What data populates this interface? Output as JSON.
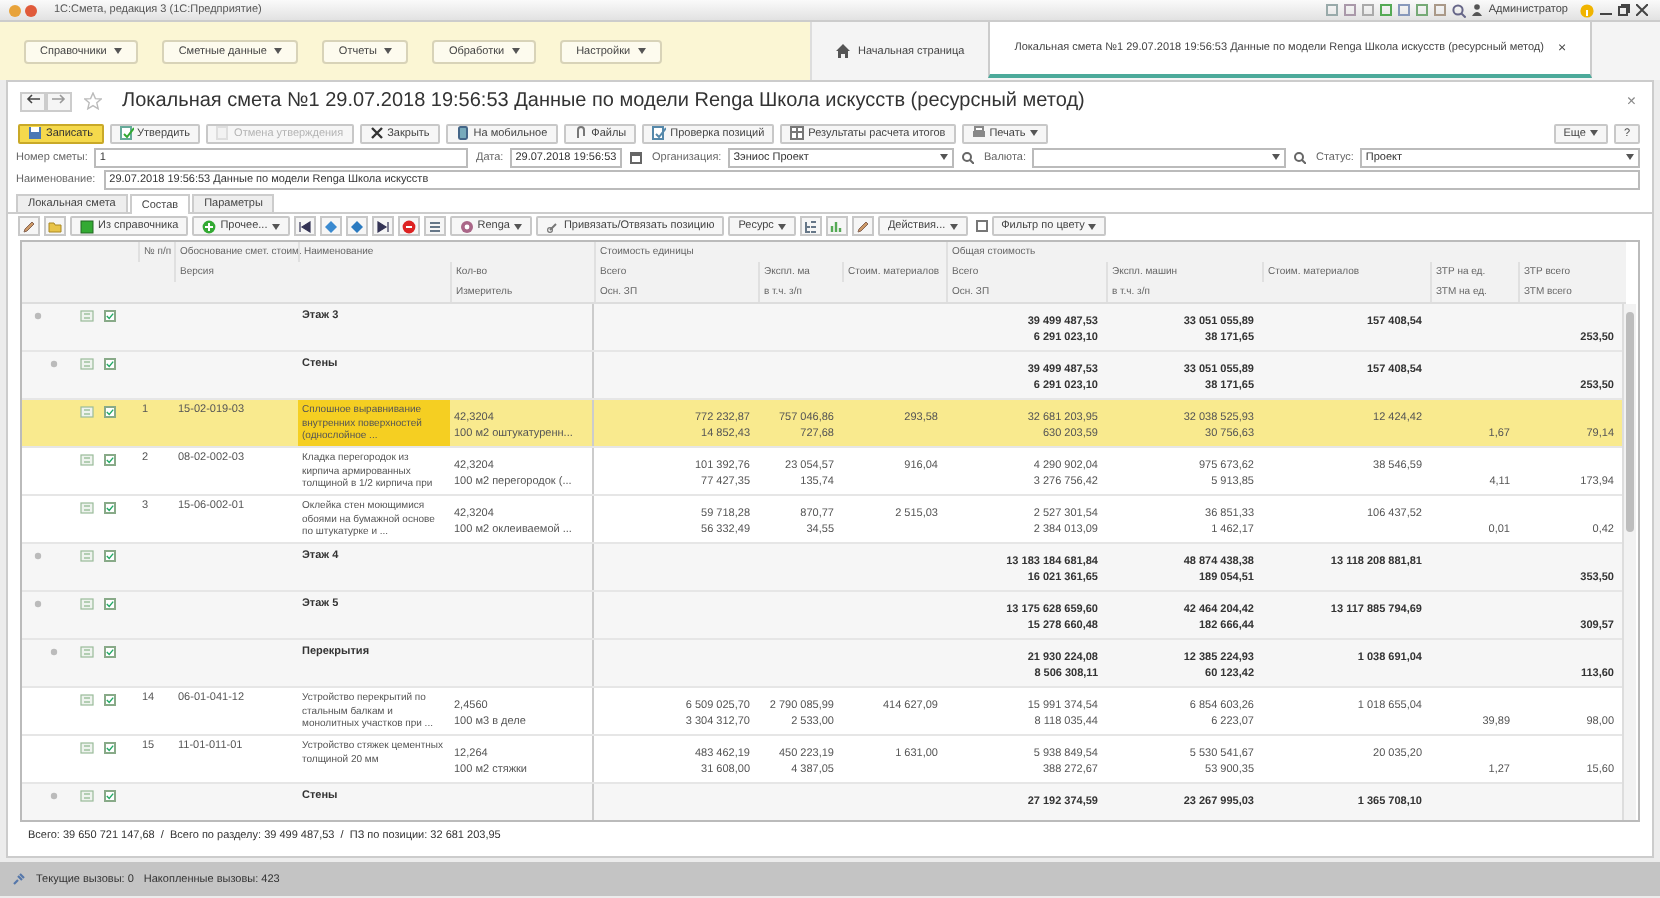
{
  "window": {
    "title": "1С:Смета, редакция 3  (1С:Предприятие)",
    "user": "Администратор"
  },
  "menu": [
    {
      "label": "Справочники"
    },
    {
      "label": "Сметные данные"
    },
    {
      "label": "Отчеты"
    },
    {
      "label": "Обработки"
    },
    {
      "label": "Настройки"
    }
  ],
  "page_tabs": [
    {
      "kind": "home",
      "label": "Начальная страница",
      "selected": false
    },
    {
      "kind": "document",
      "label": "Локальная смета №1 29.07.2018 19:56:53 Данные по модели Renga Школа искусств (ресурсный метод)",
      "selected": true,
      "close": "×"
    }
  ],
  "document": {
    "title": "Локальная смета №1 29.07.2018 19:56:53 Данные по модели Renga Школа искусств (ресурсный метод)",
    "close": "×"
  },
  "toolbar": [
    {
      "label": "Записать",
      "kind": "primary",
      "disabled": false
    },
    {
      "label": "Утвердить",
      "kind": "button",
      "disabled": false
    },
    {
      "label": "Отмена утверждения",
      "kind": "button",
      "disabled": true
    },
    {
      "label": "Закрыть",
      "kind": "button",
      "disabled": false
    },
    {
      "label": "На мобильное",
      "kind": "button",
      "disabled": false
    },
    {
      "label": "Файлы",
      "kind": "button",
      "disabled": false
    },
    {
      "label": "Проверка позиций",
      "kind": "button",
      "disabled": false
    },
    {
      "label": "Результаты расчета итогов",
      "kind": "button",
      "disabled": false
    },
    {
      "label": "Печать",
      "kind": "dropdown",
      "disabled": false
    }
  ],
  "toolbar_right": [
    {
      "label": "Еще",
      "kind": "dropdown"
    },
    {
      "label": "?",
      "kind": "button"
    }
  ],
  "fields": [
    {
      "label": "Номер сметы:",
      "value": "1",
      "kind": "text"
    },
    {
      "label": "Дата:",
      "value": "29.07.2018 19:56:53",
      "kind": "date"
    },
    {
      "label": "Организация:",
      "value": "Зэниос Проект",
      "kind": "select"
    },
    {
      "label": "Валюта:",
      "kind": "select"
    },
    {
      "label": "Статус:",
      "value": "Проект",
      "kind": "select"
    }
  ],
  "name_field": {
    "label": "Наименование:",
    "value": "29.07.2018 19:56:53 Данные по модели Renga Школа искусств"
  },
  "tabs": [
    {
      "label": "Локальная смета",
      "selected": false
    },
    {
      "label": "Состав",
      "selected": true
    },
    {
      "label": "Параметры",
      "selected": false
    }
  ],
  "table_toolbar": [
    {
      "kind": "icon"
    },
    {
      "kind": "icon"
    },
    {
      "kind": "button",
      "label": "Из справочника"
    },
    {
      "kind": "dropdown",
      "label": "Прочее..."
    },
    {
      "kind": "icon"
    },
    {
      "kind": "icon"
    },
    {
      "kind": "icon"
    },
    {
      "kind": "icon"
    },
    {
      "kind": "icon"
    },
    {
      "kind": "icon"
    },
    {
      "kind": "dropdown",
      "label": "Renga"
    },
    {
      "kind": "button",
      "label": "Привязать/Отвязать позицию"
    },
    {
      "kind": "dropdown",
      "label": "Ресурс"
    },
    {
      "kind": "icon"
    },
    {
      "kind": "icon"
    },
    {
      "kind": "icon"
    },
    {
      "kind": "dropdown",
      "label": "Действия..."
    },
    {
      "kind": "checkbox",
      "label": "Фильтр по цвету",
      "checked": false
    }
  ],
  "table": {
    "columns": [
      {
        "kind": "text",
        "line_1": "№ п/п"
      },
      {
        "kind": "text",
        "line_1": "Обоснование смет. стоим.",
        "line_2": "Версия"
      },
      {
        "kind": "text",
        "line_1": "Наименование"
      },
      {
        "kind": "measure",
        "line_2": "Кол-во",
        "line_3": "Измеритель"
      },
      {
        "kind": "group",
        "label": "Стоимость единицы",
        "columns": [
          {
            "kind": "number",
            "line_2": "Всего",
            "line_3": "Осн. ЗП"
          },
          {
            "kind": "number",
            "line_2": "Экспл. ма",
            "line_3": "в т.ч. з/п"
          },
          {
            "kind": "number",
            "line_2": "Стоим. материалов"
          }
        ]
      },
      {
        "kind": "group",
        "label": "Общая стоимость",
        "columns": [
          {
            "kind": "number",
            "line_2": "Всего",
            "line_3": "Осн. ЗП"
          },
          {
            "kind": "number",
            "line_2": "Экспл. машин",
            "line_3": "в т.ч. з/п"
          },
          {
            "kind": "number",
            "line_2": "Стоим. материалов"
          }
        ]
      },
      {
        "kind": "number",
        "line_2": "ЗТР на ед.",
        "line_3": "ЗТМ на ед."
      },
      {
        "kind": "number",
        "line_2": "ЗТР всего",
        "line_3": "ЗТМ всего"
      }
    ],
    "rows": [
      {
        "kind": "group",
        "checked": true,
        "selected": false,
        "cells": [
          null,
          null,
          {
            "line_1": "Этаж 3"
          },
          null,
          null,
          null,
          null,
          {
            "line_1": "39 499 487,53",
            "line_2": "6 291 023,10"
          },
          {
            "line_1": "33 051 055,89",
            "line_2": "38 171,65"
          },
          {
            "line_1": "157 408,54"
          },
          null,
          {
            "line_2": "253,50"
          }
        ],
        "children": [
          {
            "kind": "group",
            "checked": true,
            "selected": false,
            "cells": [
              null,
              null,
              {
                "line_1": "Стены"
              },
              null,
              null,
              null,
              null,
              {
                "line_1": "39 499 487,53",
                "line_2": "6 291 023,10"
              },
              {
                "line_1": "33 051 055,89",
                "line_2": "38 171,65"
              },
              {
                "line_1": "157 408,54"
              },
              null,
              {
                "line_2": "253,50"
              }
            ],
            "children": [
              {
                "kind": "position",
                "checked": true,
                "selected": true,
                "cells": [
                  {
                    "line_1": "1"
                  },
                  {
                    "line_1": "15-02-019-03"
                  },
                  {
                    "line_1": "Сплошное выравнивание внутренних поверхностей (однослойное ..."
                  },
                  {
                    "line_1": "42,3204",
                    "line_2": "100 м2 оштукатуренн..."
                  },
                  {
                    "line_1": "772 232,87",
                    "line_2": "14 852,43"
                  },
                  {
                    "line_1": "757 046,86",
                    "line_2": "727,68"
                  },
                  {
                    "line_1": "293,58"
                  },
                  {
                    "line_1": "32 681 203,95",
                    "line_2": "630 203,59"
                  },
                  {
                    "line_1": "32 038 525,93",
                    "line_2": "30 756,63"
                  },
                  {
                    "line_1": "12 424,42"
                  },
                  {
                    "line_2": "1,67"
                  },
                  {
                    "line_2": "79,14"
                  }
                ]
              },
              {
                "kind": "position",
                "checked": true,
                "selected": false,
                "cells": [
                  {
                    "line_1": "2"
                  },
                  {
                    "line_1": "08-02-002-03"
                  },
                  {
                    "line_1": "Кладка перегородок из кирпича армированных толщиной в 1/2 кирпича при"
                  },
                  {
                    "line_1": "42,3204",
                    "line_2": "100 м2 перегородок (..."
                  },
                  {
                    "line_1": "101 392,76",
                    "line_2": "77 427,35"
                  },
                  {
                    "line_1": "23 054,57",
                    "line_2": "135,74"
                  },
                  {
                    "line_1": "916,04"
                  },
                  {
                    "line_1": "4 290 902,04",
                    "line_2": "3 276 756,42"
                  },
                  {
                    "line_1": "975 673,62",
                    "line_2": "5 913,85"
                  },
                  {
                    "line_1": "38 546,59"
                  },
                  {
                    "line_2": "4,11"
                  },
                  {
                    "line_2": "173,94"
                  }
                ]
              },
              {
                "kind": "position",
                "checked": true,
                "selected": false,
                "cells": [
                  {
                    "line_1": "3"
                  },
                  {
                    "line_1": "15-06-002-01"
                  },
                  {
                    "line_1": "Оклейка стен моющимися обоями на бумажной основе по штукатурке и ..."
                  },
                  {
                    "line_1": "42,3204",
                    "line_2": "100 м2 оклеиваемой ..."
                  },
                  {
                    "line_1": "59 718,28",
                    "line_2": "56 332,49"
                  },
                  {
                    "line_1": "870,77",
                    "line_2": "34,55"
                  },
                  {
                    "line_1": "2 515,03"
                  },
                  {
                    "line_1": "2 527 301,54",
                    "line_2": "2 384 013,09"
                  },
                  {
                    "line_1": "36 851,33",
                    "line_2": "1 462,17"
                  },
                  {
                    "line_1": "106 437,52"
                  },
                  {
                    "line_2": "0,01"
                  },
                  {
                    "line_2": "0,42"
                  }
                ]
              }
            ]
          }
        ]
      },
      {
        "kind": "group",
        "checked": true,
        "selected": false,
        "cells": [
          null,
          null,
          {
            "line_1": "Этаж 4"
          },
          null,
          null,
          null,
          null,
          {
            "line_1": "13 183 184 681,84",
            "line_2": "16 021 361,65"
          },
          {
            "line_1": "48 874 438,38",
            "line_2": "189 054,51"
          },
          {
            "line_1": "13 118 208 881,81"
          },
          null,
          {
            "line_2": "353,50"
          }
        ]
      },
      {
        "kind": "group",
        "checked": true,
        "selected": false,
        "cells": [
          null,
          null,
          {
            "line_1": "Этаж 5"
          },
          null,
          null,
          null,
          null,
          {
            "line_1": "13 175 628 659,60",
            "line_2": "15 278 660,48"
          },
          {
            "line_1": "42 464 204,42",
            "line_2": "182 666,44"
          },
          {
            "line_1": "13 117 885 794,69"
          },
          null,
          {
            "line_2": "309,57"
          }
        ],
        "children": [
          {
            "kind": "group",
            "checked": true,
            "selected": false,
            "cells": [
              null,
              null,
              {
                "line_1": "Перекрытия"
              },
              null,
              null,
              null,
              null,
              {
                "line_1": "21 930 224,08",
                "line_2": "8 506 308,11"
              },
              {
                "line_1": "12 385 224,93",
                "line_2": "60 123,42"
              },
              {
                "line_1": "1 038 691,04"
              },
              null,
              {
                "line_2": "113,60"
              }
            ],
            "children": [
              {
                "kind": "position",
                "checked": true,
                "selected": false,
                "cells": [
                  {
                    "line_1": "14"
                  },
                  {
                    "line_1": "06-01-041-12"
                  },
                  {
                    "line_1": "Устройство перекрытий по стальным балкам и монолитных участков при ..."
                  },
                  {
                    "line_1": "2,4560",
                    "line_2": "100 м3 в деле"
                  },
                  {
                    "line_1": "6 509 025,70",
                    "line_2": "3 304 312,70"
                  },
                  {
                    "line_1": "2 790 085,99",
                    "line_2": "2 533,00"
                  },
                  {
                    "line_1": "414 627,09"
                  },
                  {
                    "line_1": "15 991 374,54",
                    "line_2": "8 118 035,44"
                  },
                  {
                    "line_1": "6 854 603,26",
                    "line_2": "6 223,07"
                  },
                  {
                    "line_1": "1 018 655,04"
                  },
                  {
                    "line_2": "39,89"
                  },
                  {
                    "line_2": "98,00"
                  }
                ]
              },
              {
                "kind": "position",
                "checked": true,
                "selected": false,
                "cells": [
                  {
                    "line_1": "15"
                  },
                  {
                    "line_1": "11-01-011-01"
                  },
                  {
                    "line_1": "Устройство стяжек цементных толщиной 20 мм"
                  },
                  {
                    "line_1": "12,264",
                    "line_2": "100 м2 стяжки"
                  },
                  {
                    "line_1": "483 462,19",
                    "line_2": "31 608,00"
                  },
                  {
                    "line_1": "450 223,19",
                    "line_2": "4 387,05"
                  },
                  {
                    "line_1": "1 631,00"
                  },
                  {
                    "line_1": "5 938 849,54",
                    "line_2": "388 272,67"
                  },
                  {
                    "line_1": "5 530 541,67",
                    "line_2": "53 900,35"
                  },
                  {
                    "line_1": "20 035,20"
                  },
                  {
                    "line_2": "1,27"
                  },
                  {
                    "line_2": "15,60"
                  }
                ]
              }
            ]
          },
          {
            "kind": "group",
            "checked": true,
            "selected": false,
            "cells": [
              null,
              null,
              {
                "line_1": "Стены"
              },
              null,
              null,
              null,
              null,
              {
                "line_1": "27 192 374,59"
              },
              {
                "line_1": "23 267 995,03"
              },
              {
                "line_1": "1 365 708,10"
              },
              null,
              null
            ]
          }
        ]
      }
    ]
  },
  "totals": "Всего: 39 650 721 147,68  /  Всего по разделу: 39 499 487,53  /  ПЗ по позиции: 32 681 203,95",
  "status_bar": {
    "current_calls": "Текущие вызовы: 0",
    "accumulated_calls": "Накопленные вызовы: 423"
  }
}
